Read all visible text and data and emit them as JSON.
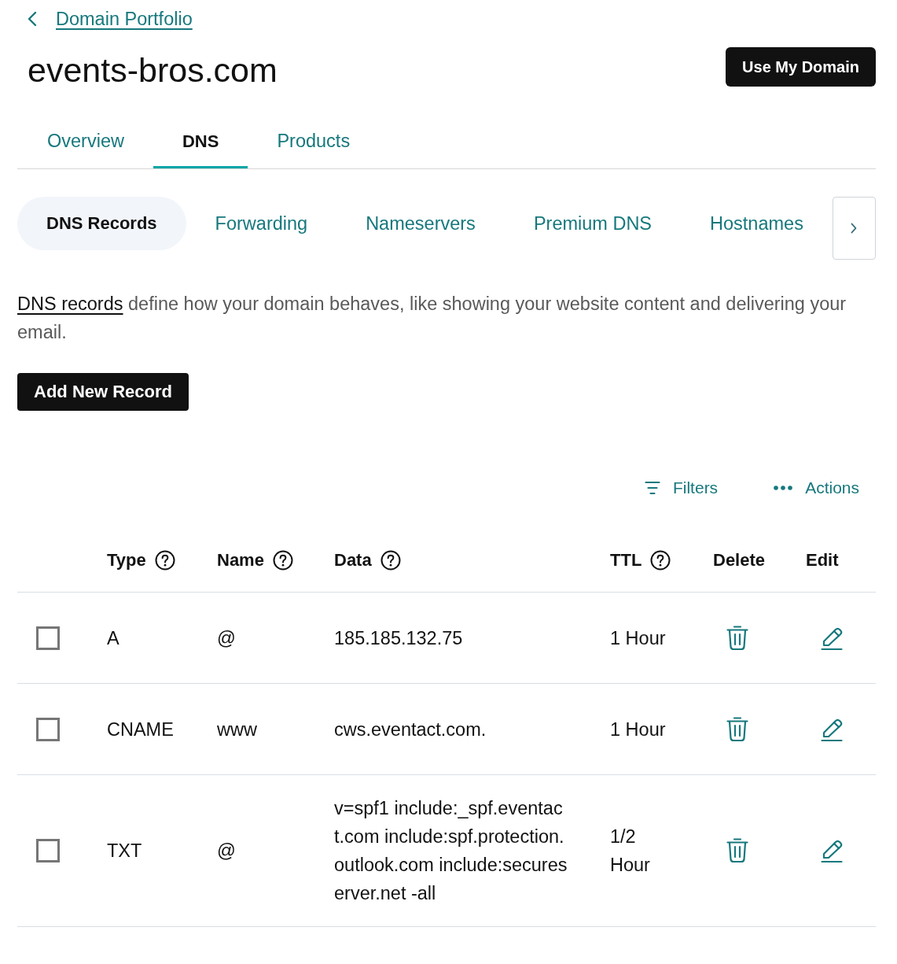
{
  "breadcrumb": {
    "label": "Domain Portfolio"
  },
  "domain_title": "events-bros.com",
  "primary_button": {
    "label": "Use My Domain"
  },
  "tabs": [
    {
      "label": "Overview",
      "selected": false
    },
    {
      "label": "DNS",
      "selected": true
    },
    {
      "label": "Products",
      "selected": false
    }
  ],
  "subtabs": [
    {
      "label": "DNS Records",
      "selected": true
    },
    {
      "label": "Forwarding",
      "selected": false
    },
    {
      "label": "Nameservers",
      "selected": false
    },
    {
      "label": "Premium DNS",
      "selected": false
    },
    {
      "label": "Hostnames",
      "selected": false
    }
  ],
  "intro": {
    "link": "DNS records",
    "text": "define how your domain behaves, like showing your website content and delivering your email."
  },
  "add_button": {
    "label": "Add New Record"
  },
  "toolbar": [
    {
      "kind": "filter",
      "label": "Filters"
    },
    {
      "kind": "more",
      "label": "Actions"
    }
  ],
  "table": {
    "columns": [
      {
        "label": "Type",
        "help": true
      },
      {
        "label": "Name",
        "help": true
      },
      {
        "label": "Data",
        "help": true
      },
      {
        "label": "TTL",
        "help": true
      },
      {
        "label": "Delete",
        "help": false
      },
      {
        "label": "Edit",
        "help": false
      }
    ],
    "rows": [
      {
        "checked": false,
        "type": "A",
        "name": "@",
        "data": "185.185.132.75",
        "ttl": "1 Hour"
      },
      {
        "checked": false,
        "type": "CNAME",
        "name": "www",
        "data": "cws.eventact.com.",
        "ttl": "1 Hour"
      },
      {
        "checked": false,
        "type": "TXT",
        "name": "@",
        "data": "v=spf1 include:_spf.eventact.com include:spf.protection.outlook.com include:secureserver.net -all",
        "ttl": "1/2 Hour"
      }
    ]
  }
}
